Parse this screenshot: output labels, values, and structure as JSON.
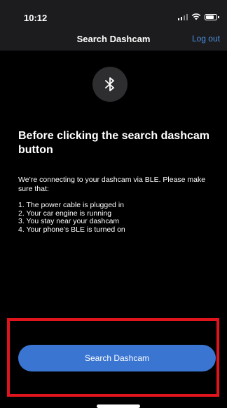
{
  "status_bar": {
    "time": "10:12"
  },
  "nav": {
    "title": "Search Dashcam",
    "logout_label": "Log out"
  },
  "icons": {
    "main": "bluetooth-icon"
  },
  "content": {
    "heading": "Before clicking the search dashcam button",
    "intro": "We’re connecting to your dashcam via BLE. Please make sure that:",
    "checklist": [
      "1. The power cable is plugged in",
      "2. Your car engine is running",
      "3. You stay near your dashcam",
      "4. Your phone’s BLE is turned on"
    ]
  },
  "actions": {
    "search_label": "Search Dashcam"
  },
  "colors": {
    "accent": "#3a75d2",
    "link": "#4a90e2",
    "highlight": "#e0141c"
  }
}
